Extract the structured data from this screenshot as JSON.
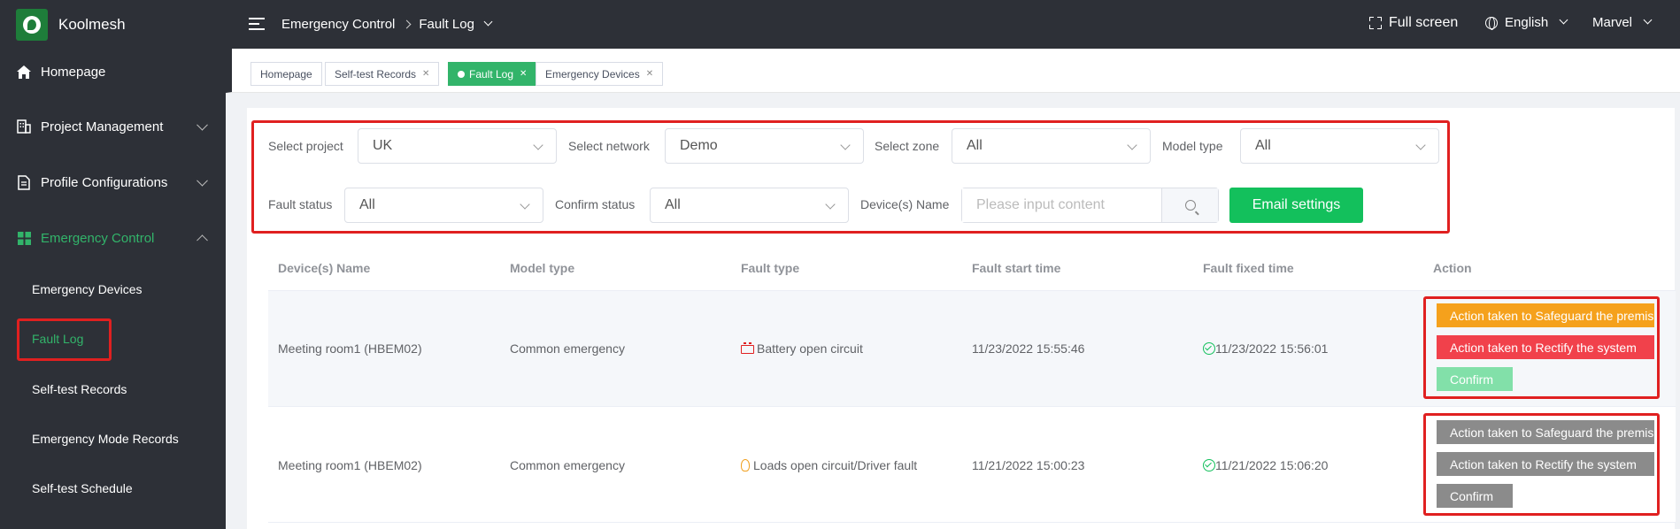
{
  "sidebar": {
    "brand": "Koolmesh",
    "menu": [
      {
        "label": "Homepage"
      },
      {
        "label": "Project Management"
      },
      {
        "label": "Profile Configurations"
      },
      {
        "label": "Emergency Control"
      }
    ],
    "submenu": [
      {
        "label": "Emergency Devices"
      },
      {
        "label": "Fault Log"
      },
      {
        "label": "Self-test Records"
      },
      {
        "label": "Emergency Mode Records"
      },
      {
        "label": "Self-test Schedule"
      }
    ]
  },
  "topbar": {
    "breadcrumb": [
      "Emergency Control",
      "Fault Log"
    ],
    "fullscreen": "Full screen",
    "language": "English",
    "user": "Marvel"
  },
  "tabs": [
    {
      "label": "Homepage"
    },
    {
      "label": "Self-test Records"
    },
    {
      "label": "Fault Log"
    },
    {
      "label": "Emergency Devices"
    }
  ],
  "filters": {
    "project_label": "Select project",
    "project_value": "UK",
    "network_label": "Select network",
    "network_value": "Demo",
    "zone_label": "Select zone",
    "zone_value": "All",
    "model_label": "Model type",
    "model_value": "All",
    "fault_status_label": "Fault status",
    "fault_status_value": "All",
    "confirm_status_label": "Confirm status",
    "confirm_status_value": "All",
    "device_name_label": "Device(s) Name",
    "device_name_placeholder": "Please input content",
    "email_button": "Email settings"
  },
  "table": {
    "headers": [
      "Device(s) Name",
      "Model type",
      "Fault type",
      "Fault start time",
      "Fault fixed time",
      "Action"
    ],
    "rows": [
      {
        "device": "Meeting room1 (HBEM02)",
        "model": "Common emergency",
        "fault_type": "Battery open circuit",
        "fault_icon": "battery-icon",
        "start": "11/23/2022 15:55:46",
        "fixed": "11/23/2022 15:56:01",
        "actions": [
          "Action taken to Safeguard the premises",
          "Action taken to Rectify the system",
          "Confirm"
        ]
      },
      {
        "device": "Meeting room1 (HBEM02)",
        "model": "Common emergency",
        "fault_type": "Loads open circuit/Driver fault",
        "fault_icon": "bulb-icon",
        "start": "11/21/2022 15:00:23",
        "fixed": "11/21/2022 15:06:20",
        "actions": [
          "Action taken to Safeguard the premises",
          "Action taken to Rectify the system",
          "Confirm"
        ]
      }
    ]
  },
  "colors": {
    "sidebar_bg": "#2d3037",
    "accent": "#32b46a",
    "email_btn": "#13c05c",
    "safeguard_active": "#f5a11c",
    "rectify_active": "#f1414b",
    "confirm_active": "#82e0a9",
    "disabled_btn": "#8b8b8b",
    "highlight": "#e02020"
  }
}
